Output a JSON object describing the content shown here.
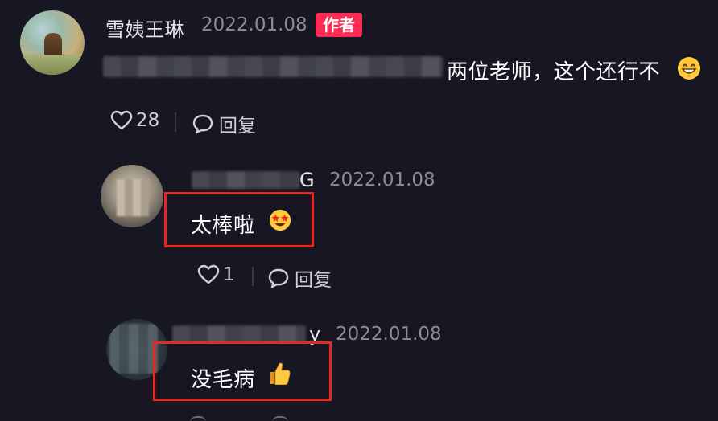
{
  "comments": [
    {
      "author": "雪姨王琳",
      "date": "2022.01.08",
      "badge": "作者",
      "text": "两位老师，这个还行不",
      "emoji": "grinning-face-emoji",
      "likes": "28",
      "reply_label": "回复"
    },
    {
      "author_visible": "G",
      "date": "2022.01.08",
      "text": "太棒啦",
      "emoji": "star-struck-emoji",
      "likes": "1",
      "reply_label": "回复"
    },
    {
      "author_visible": "y",
      "date": "2022.01.08",
      "text": "没毛病",
      "emoji": "thumbs-up-emoji"
    }
  ],
  "colors": {
    "background": "#161722",
    "badge": "#fe2c55",
    "highlight_box": "#e8281c"
  }
}
